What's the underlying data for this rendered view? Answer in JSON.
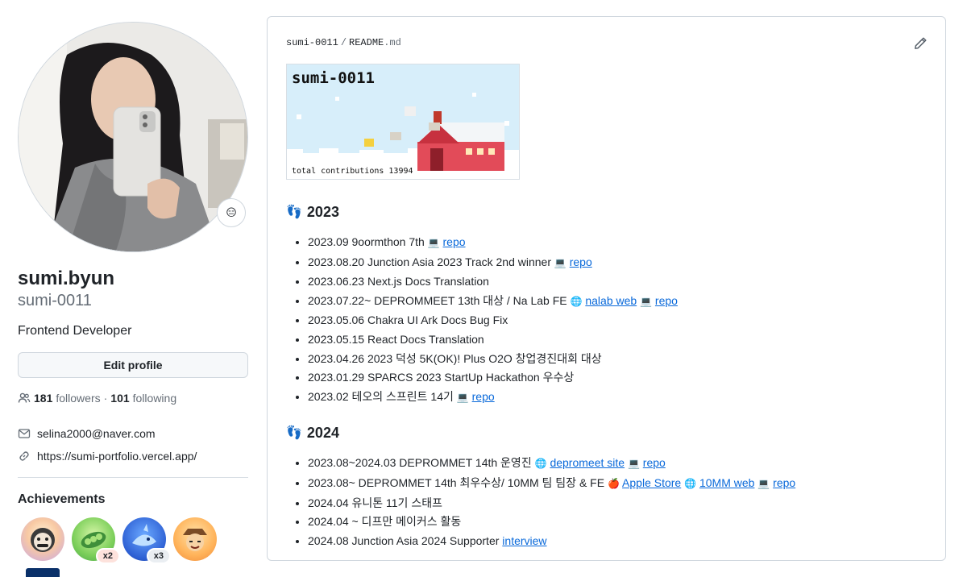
{
  "profile": {
    "name": "sumi.byun",
    "login": "sumi-0011",
    "bio": "Frontend Developer",
    "edit_label": "Edit profile",
    "status_emoji": "😑",
    "followers_count": "181",
    "followers_label": "followers",
    "following_count": "101",
    "following_label": "following",
    "separator": "·",
    "email": "selina2000@naver.com",
    "website": "https://sumi-portfolio.vercel.app/"
  },
  "achievements": {
    "title": "Achievements",
    "badges": [
      {
        "icon": "pull-shark-icon",
        "count": ""
      },
      {
        "icon": "pair-extraordinaire-icon",
        "count": "x2"
      },
      {
        "icon": "shark-icon",
        "count": "x3"
      },
      {
        "icon": "yolo-icon",
        "count": ""
      }
    ]
  },
  "readme": {
    "owner": "sumi-0011",
    "slash": "/",
    "file": "README",
    "ext": ".md",
    "banner_title": "sumi-0011",
    "banner_footer": "total contributions 13994",
    "sections": [
      {
        "year": "2023",
        "icon": "👣",
        "items": [
          {
            "text": "2023.09 9oormthon 7th",
            "links": [
              {
                "emoji": "💻",
                "label": "repo"
              }
            ]
          },
          {
            "text": "2023.08.20 Junction Asia 2023 Track 2nd winner",
            "links": [
              {
                "emoji": "💻",
                "label": "repo"
              }
            ]
          },
          {
            "text": "2023.06.23 Next.js Docs Translation",
            "links": []
          },
          {
            "text": "2023.07.22~ DEPROMMEET 13th 대상 / Na Lab FE",
            "links": [
              {
                "emoji": "🌐",
                "label": "nalab web"
              },
              {
                "emoji": "💻",
                "label": "repo"
              }
            ]
          },
          {
            "text": "2023.05.06 Chakra UI Ark Docs Bug Fix",
            "links": []
          },
          {
            "text": "2023.05.15 React Docs Translation",
            "links": []
          },
          {
            "text": "2023.04.26 2023 덕성 5K(OK)! Plus O2O 창업경진대회 대상",
            "links": []
          },
          {
            "text": "2023.01.29 SPARCS 2023 StartUp Hackathon 우수상",
            "links": []
          },
          {
            "text": "2023.02 테오의 스프린트 14기",
            "links": [
              {
                "emoji": "💻",
                "label": "repo"
              }
            ]
          }
        ]
      },
      {
        "year": "2024",
        "icon": "👣",
        "items": [
          {
            "text": "2023.08~2024.03 DEPROMMET 14th 운영진",
            "links": [
              {
                "emoji": "🌐",
                "label": "depromeet site"
              },
              {
                "emoji": "💻",
                "label": "repo"
              }
            ]
          },
          {
            "text": "2023.08~ DEPROMMET 14th 최우수상/ 10MM 팀 팀장 & FE",
            "links": [
              {
                "emoji": "🍎",
                "label": "Apple Store"
              },
              {
                "emoji": "🌐",
                "label": "10MM web"
              },
              {
                "emoji": "💻",
                "label": "repo"
              }
            ]
          },
          {
            "text": "2024.04 유니톤 11기 스태프",
            "links": []
          },
          {
            "text": "2024.04 ~ 디프만 메이커스 활동",
            "links": []
          },
          {
            "text": "2024.08 Junction Asia 2024 Supporter",
            "links": [
              {
                "emoji": "",
                "label": "interview"
              }
            ]
          }
        ]
      }
    ]
  },
  "colors": {
    "link": "#0969da",
    "muted": "#656d76",
    "border": "#d0d7de"
  }
}
